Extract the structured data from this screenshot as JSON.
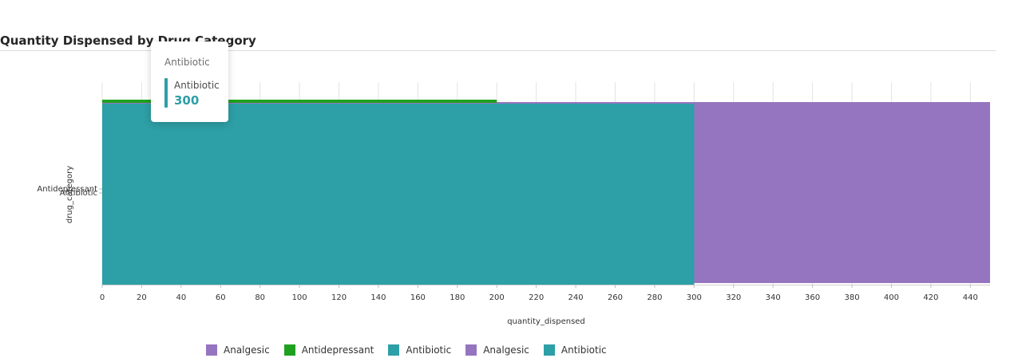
{
  "chart_data": {
    "type": "bar",
    "orientation": "horizontal",
    "title": "Quantity Dispensed by Drug Category",
    "xlabel": "quantity_dispensed",
    "ylabel": "drug_category",
    "xlim": [
      0,
      450
    ],
    "xticks": [
      0,
      20,
      40,
      60,
      80,
      100,
      120,
      140,
      160,
      180,
      200,
      220,
      240,
      260,
      280,
      300,
      320,
      340,
      360,
      380,
      400,
      420,
      440
    ],
    "y_tick_labels": [
      "Antidepressant",
      "Antibiotic"
    ],
    "grid": true,
    "legend_position": "bottom",
    "series": [
      {
        "name": "Analgesic",
        "value": 450,
        "color": "#9575c0"
      },
      {
        "name": "Antidepressant",
        "value": 200,
        "color": "#1ea11e"
      },
      {
        "name": "Antibiotic",
        "value": 300,
        "color": "#2d9fa6"
      },
      {
        "name": "Analgesic",
        "value": 450,
        "color": "#9575c0"
      },
      {
        "name": "Antibiotic",
        "value": 300,
        "color": "#2d9fa6"
      }
    ]
  },
  "tooltip": {
    "header": "Antibiotic",
    "series_label": "Antibiotic",
    "value": "300",
    "color": "#2d9fa6"
  }
}
